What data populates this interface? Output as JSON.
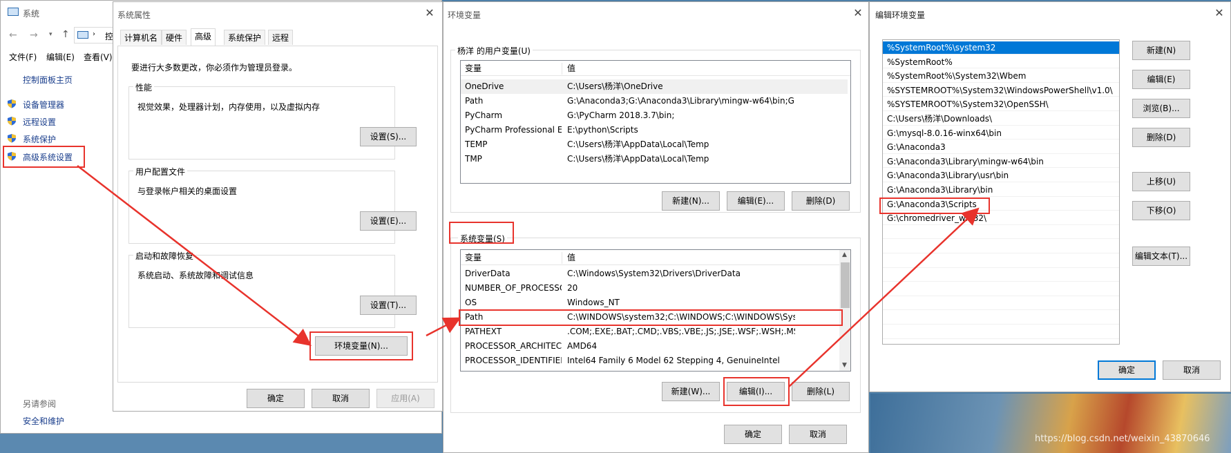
{
  "system_window": {
    "title": "系统",
    "address_fragment": "控",
    "menu": [
      "文件(F)",
      "编辑(E)",
      "查看(V)"
    ],
    "control_panel_home": "控制面板主页",
    "links": [
      "设备管理器",
      "远程设置",
      "系统保护",
      "高级系统设置"
    ],
    "see_also": "另请参阅",
    "security_link": "安全和维护"
  },
  "props_window": {
    "title": "系统属性",
    "tabs": [
      "计算机名",
      "硬件",
      "高级",
      "系统保护",
      "远程"
    ],
    "admin_note": "要进行大多数更改，你必须作为管理员登录。",
    "performance": {
      "label": "性能",
      "desc": "视觉效果，处理器计划，内存使用，以及虚拟内存",
      "button": "设置(S)..."
    },
    "profile": {
      "label": "用户配置文件",
      "desc": "与登录帐户相关的桌面设置",
      "button": "设置(E)..."
    },
    "startup": {
      "label": "启动和故障恢复",
      "desc": "系统启动、系统故障和调试信息",
      "button": "设置(T)..."
    },
    "env_button": "环境变量(N)...",
    "ok": "确定",
    "cancel": "取消",
    "apply": "应用(A)"
  },
  "env_window": {
    "title": "环境变量",
    "user_group": "杨洋 的用户变量(U)",
    "col_var": "变量",
    "col_val": "值",
    "user_vars": [
      {
        "name": "OneDrive",
        "value": "C:\\Users\\杨洋\\OneDrive"
      },
      {
        "name": "Path",
        "value": "G:\\Anaconda3;G:\\Anaconda3\\Library\\mingw-w64\\bin;G:\\Anac..."
      },
      {
        "name": "PyCharm",
        "value": "G:\\PyCharm 2018.3.7\\bin;"
      },
      {
        "name": "PyCharm Professional Edi...",
        "value": "E:\\python\\Scripts"
      },
      {
        "name": "TEMP",
        "value": "C:\\Users\\杨洋\\AppData\\Local\\Temp"
      },
      {
        "name": "TMP",
        "value": "C:\\Users\\杨洋\\AppData\\Local\\Temp"
      }
    ],
    "user_new": "新建(N)...",
    "user_edit": "编辑(E)...",
    "user_delete": "删除(D)",
    "sys_group": "系统变量(S)",
    "sys_vars": [
      {
        "name": "DriverData",
        "value": "C:\\Windows\\System32\\Drivers\\DriverData"
      },
      {
        "name": "NUMBER_OF_PROCESSORS",
        "value": "20"
      },
      {
        "name": "OS",
        "value": "Windows_NT"
      },
      {
        "name": "Path",
        "value": "C:\\WINDOWS\\system32;C:\\WINDOWS;C:\\WINDOWS\\System..."
      },
      {
        "name": "PATHEXT",
        "value": ".COM;.EXE;.BAT;.CMD;.VBS;.VBE;.JS;.JSE;.WSF;.WSH;.MSC"
      },
      {
        "name": "PROCESSOR_ARCHITECT...",
        "value": "AMD64"
      },
      {
        "name": "PROCESSOR_IDENTIFIER",
        "value": "Intel64 Family 6 Model 62 Stepping 4, GenuineIntel"
      }
    ],
    "sys_new": "新建(W)...",
    "sys_edit": "编辑(I)...",
    "sys_delete": "删除(L)",
    "ok": "确定",
    "cancel": "取消"
  },
  "edit_window": {
    "title": "编辑环境变量",
    "entries": [
      "%SystemRoot%\\system32",
      "%SystemRoot%",
      "%SystemRoot%\\System32\\Wbem",
      "%SYSTEMROOT%\\System32\\WindowsPowerShell\\v1.0\\",
      "%SYSTEMROOT%\\System32\\OpenSSH\\",
      "C:\\Users\\杨洋\\Downloads\\",
      "G:\\mysql-8.0.16-winx64\\bin",
      "G:\\Anaconda3",
      "G:\\Anaconda3\\Library\\mingw-w64\\bin",
      "G:\\Anaconda3\\Library\\usr\\bin",
      "G:\\Anaconda3\\Library\\bin",
      "G:\\Anaconda3\\Scripts",
      "G:\\chromedriver_win32\\"
    ],
    "buttons": [
      "新建(N)",
      "编辑(E)",
      "浏览(B)...",
      "删除(D)",
      "上移(U)",
      "下移(O)",
      "编辑文本(T)..."
    ],
    "ok": "确定",
    "cancel": "取消"
  },
  "watermark": "https://blog.csdn.net/weixin_43870646",
  "colors": {
    "highlight": "#e8332c",
    "selection": "#0078d7",
    "link": "#1a3e8c"
  }
}
